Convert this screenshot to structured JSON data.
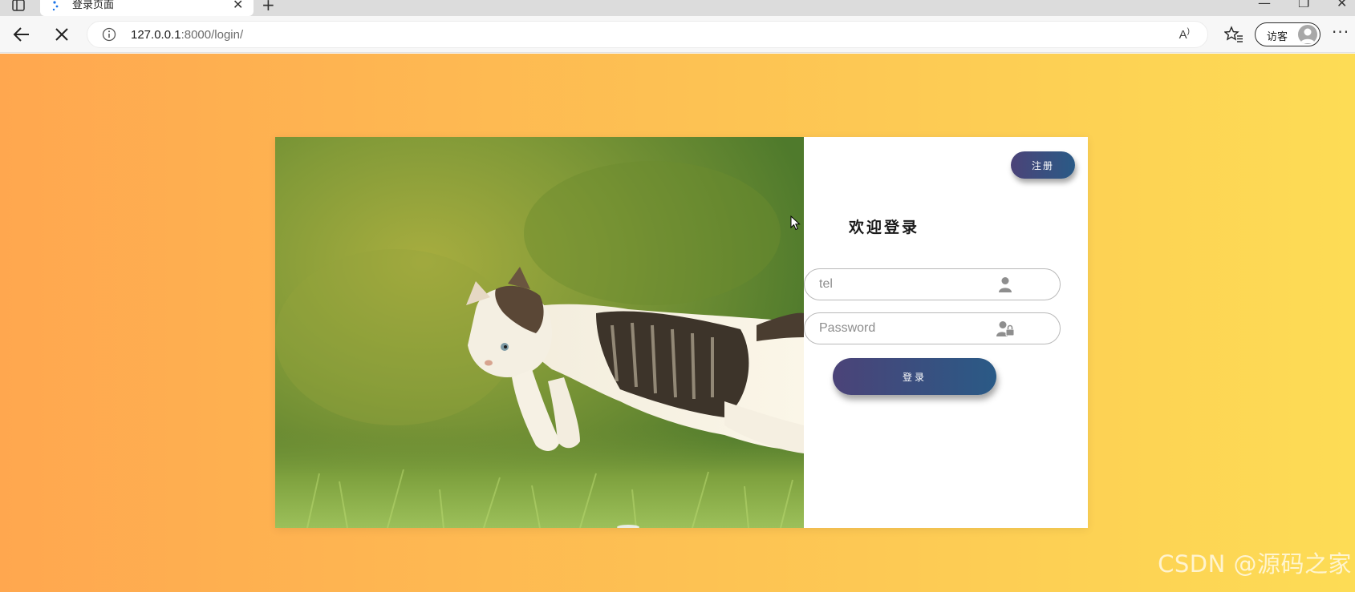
{
  "browser": {
    "tab": {
      "title": "登录页面"
    },
    "address_bar": {
      "host": "127.0.0.1",
      "rest": ":8000/login/"
    },
    "profile": {
      "label": "访客"
    },
    "icons": {
      "sidebar": "sidebar-toggle-icon",
      "loading": "loading-spinner-icon",
      "close_tab": "close-icon",
      "new_tab": "plus-icon",
      "back": "arrow-left-icon",
      "stop": "stop-icon",
      "info": "info-icon",
      "read_aloud": "read-aloud-icon",
      "favorites": "favorites-icon",
      "more": "more-icon",
      "minimize": "minimize-icon",
      "restore": "restore-icon",
      "close_window": "close-window-icon"
    }
  },
  "page": {
    "colors": {
      "gradient_start": "#ffa74f",
      "gradient_end": "#fddc55",
      "button_start": "#4b4378",
      "button_end": "#2a5a86"
    },
    "register_button": "注册",
    "welcome_title": "欢迎登录",
    "tel_input": {
      "placeholder": "tel",
      "value": ""
    },
    "password_input": {
      "placeholder": "Password",
      "value": ""
    },
    "login_button": "登录",
    "watermark": "CSDN @源码之家"
  }
}
